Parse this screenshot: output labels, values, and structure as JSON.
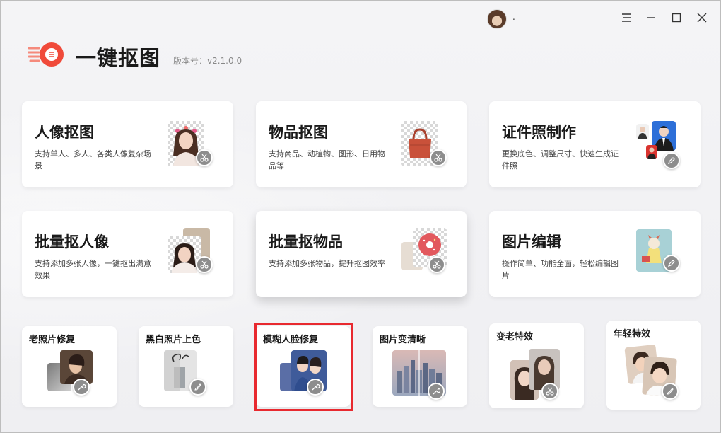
{
  "header": {
    "username": ".",
    "window_controls": [
      "menu-icon",
      "minimize-icon",
      "maximize-icon",
      "close-icon"
    ]
  },
  "logo": {
    "title": "一键抠图",
    "version": "版本号：v2.1.0.0",
    "accent_color": "#f04a3a"
  },
  "cards": [
    {
      "title": "人像抠图",
      "desc": "支持单人、多人、各类人像复杂场景",
      "icon": "scissors-icon"
    },
    {
      "title": "物品抠图",
      "desc": "支持商品、动植物、图形、日用物品等",
      "icon": "scissors-icon"
    },
    {
      "title": "证件照制作",
      "desc": "更换底色、调整尺寸、快速生成证件照",
      "icon": "pencil-icon"
    },
    {
      "title": "批量抠人像",
      "desc": "支持添加多张人像，一键抠出满意效果",
      "icon": "scissors-icon"
    },
    {
      "title": "批量抠物品",
      "desc": "支持添加多张物品，提升抠图效率",
      "icon": "scissors-icon"
    },
    {
      "title": "图片编辑",
      "desc": "操作简单、功能全面，轻松编辑图片",
      "icon": "pencil-icon"
    }
  ],
  "small_cards": [
    {
      "title": "老照片修复",
      "icon": "wrench-icon"
    },
    {
      "title": "黑白照片上色",
      "icon": "brush-icon"
    },
    {
      "title": "模糊人脸修复",
      "icon": "wrench-icon"
    },
    {
      "title": "图片变清晰",
      "icon": "wrench-icon"
    },
    {
      "title": "变老特效",
      "icon": "scissors-icon"
    },
    {
      "title": "年轻特效",
      "icon": "brush-icon"
    }
  ],
  "highlight_color": "#e8292f"
}
